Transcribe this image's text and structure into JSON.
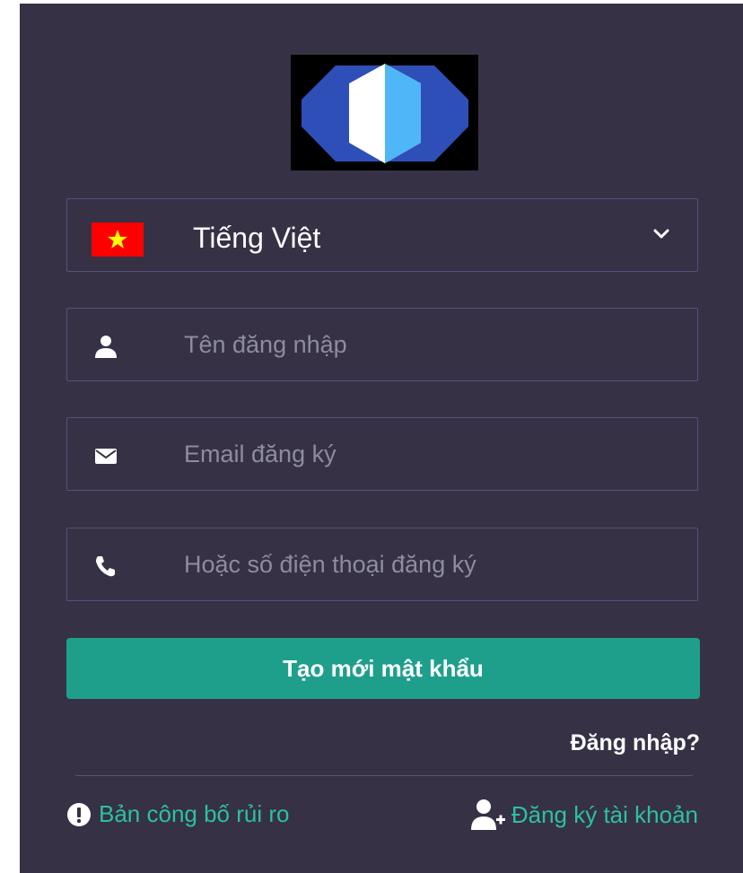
{
  "language": {
    "selected": "Tiếng Việt",
    "flag_icon": "vietnam-flag-icon",
    "dropdown_icon": "chevron-down-icon"
  },
  "form": {
    "username_placeholder": "Tên đăng nhập",
    "username_icon": "user-icon",
    "email_placeholder": "Email đăng ký",
    "email_icon": "envelope-icon",
    "phone_placeholder": "Hoặc số điện thoại đăng ký",
    "phone_icon": "phone-icon",
    "submit_label": "Tạo mới mật khẩu"
  },
  "links": {
    "login": "Đăng nhập?",
    "risk_disclosure": "Bản công bố rủi ro",
    "risk_icon": "exclamation-circle-icon",
    "register": "Đăng ký tài khoản",
    "register_icon": "user-plus-icon"
  },
  "colors": {
    "panel_bg": "#363145",
    "field_border": "#57507a",
    "accent": "#1e9f8b",
    "link": "#2bc0a4",
    "placeholder": "#8f8ca0"
  }
}
